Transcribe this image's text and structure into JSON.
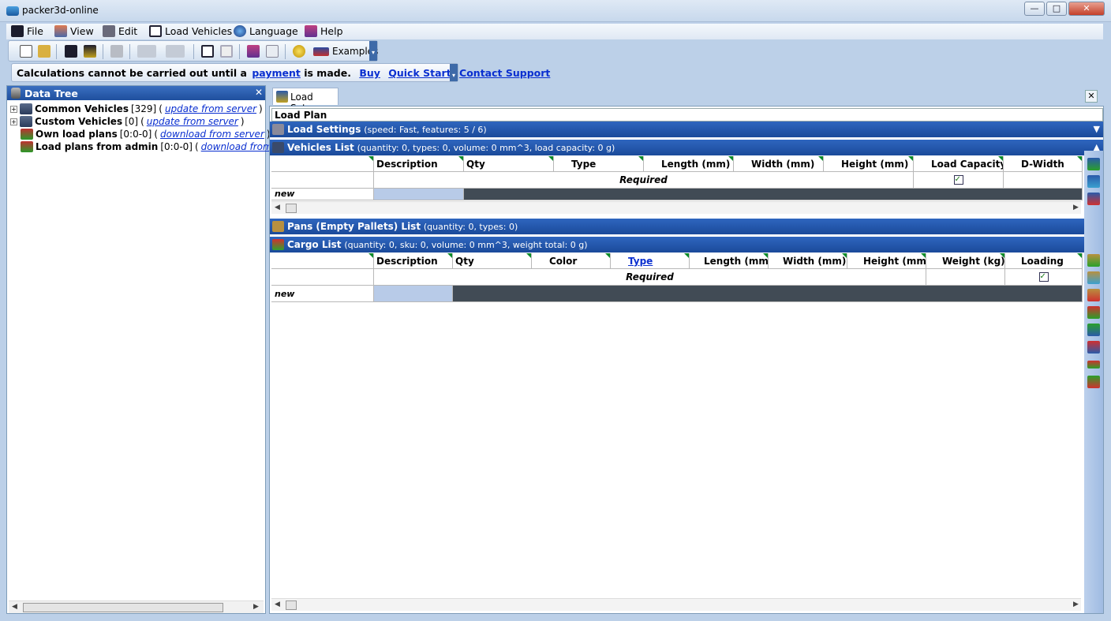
{
  "window": {
    "title": "packer3d-online",
    "minimize": "—",
    "maximize": "□",
    "close": "✕"
  },
  "menu": {
    "file": "File",
    "view": "View",
    "edit": "Edit",
    "load_vehicles": "Load Vehicles",
    "language": "Language",
    "help": "Help"
  },
  "toolbar": {
    "examples": "Examples"
  },
  "notice": {
    "text_before": "Calculations cannot be carried out until a",
    "payment": "payment",
    "text_after": "is made.",
    "buy": "Buy",
    "quick_start": "Quick Start",
    "contact": "Contact Support"
  },
  "data_tree": {
    "title": "Data Tree",
    "items": [
      {
        "name": "Common Vehicles",
        "count": "[329]",
        "link": "update from server"
      },
      {
        "name": "Custom Vehicles",
        "count": "[0]",
        "link": "update from server"
      },
      {
        "name": "Own load plans",
        "count": "[0:0-0]",
        "link": "download from server"
      },
      {
        "name": "Load plans from admin",
        "count": "[0:0-0]",
        "link": "download from server"
      }
    ]
  },
  "tabs": {
    "load_setup": "Load Setup"
  },
  "load_plan_label": "Load Plan",
  "load_settings": {
    "title": "Load Settings",
    "info": "(speed: Fast, features: 5 / 6)"
  },
  "vehicles": {
    "title": "Vehicles List",
    "info": "(quantity: 0, types: 0, volume: 0 mm^3, load capacity: 0 g)",
    "columns": [
      "Description",
      "Qty",
      "Type",
      "Length (mm)",
      "Width (mm)",
      "Height (mm)",
      "Load Capacity",
      "D-Width"
    ],
    "required": "Required",
    "new_row": "new"
  },
  "pans": {
    "title": "Pans (Empty Pallets) List",
    "info": "(quantity: 0, types: 0)"
  },
  "cargo": {
    "title": "Cargo List",
    "info": "(quantity: 0, sku: 0, volume: 0 mm^3, weight total: 0 g)",
    "columns": [
      "Description",
      "Qty",
      "Color",
      "Type",
      "Length (mm)",
      "Width (mm)",
      "Height (mm)",
      "Weight (kg)",
      "Loading"
    ],
    "required": "Required",
    "new_row": "new"
  },
  "colors": {
    "section_blue": "#1f4f9e",
    "link_blue": "#0a2fd0",
    "dark_cell": "#414b55"
  }
}
